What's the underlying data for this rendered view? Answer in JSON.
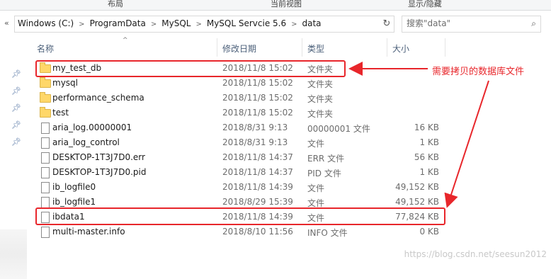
{
  "ribbon": {
    "tabs": [
      "布局",
      "当前视图",
      "显示/隐藏"
    ]
  },
  "address": {
    "crumbs": [
      "Windows (C:)",
      "ProgramData",
      "MySQL",
      "MySQL Servcie 5.6",
      "data"
    ]
  },
  "search": {
    "placeholder": "搜索\"data\""
  },
  "columns": {
    "name": "名称",
    "date": "修改日期",
    "type": "类型",
    "size": "大小"
  },
  "files": [
    {
      "name": "my_test_db",
      "date": "2018/11/8 15:02",
      "type": "文件夹",
      "size": "",
      "kind": "folder"
    },
    {
      "name": "mysql",
      "date": "2018/11/8 15:02",
      "type": "文件夹",
      "size": "",
      "kind": "folder"
    },
    {
      "name": "performance_schema",
      "date": "2018/11/8 15:02",
      "type": "文件夹",
      "size": "",
      "kind": "folder"
    },
    {
      "name": "test",
      "date": "2018/11/8 15:02",
      "type": "文件夹",
      "size": "",
      "kind": "folder"
    },
    {
      "name": "aria_log.00000001",
      "date": "2018/8/31 9:13",
      "type": "00000001 文件",
      "size": "16 KB",
      "kind": "file"
    },
    {
      "name": "aria_log_control",
      "date": "2018/8/31 9:13",
      "type": "文件",
      "size": "1 KB",
      "kind": "file"
    },
    {
      "name": "DESKTOP-1T3J7D0.err",
      "date": "2018/11/8 14:37",
      "type": "ERR 文件",
      "size": "56 KB",
      "kind": "file"
    },
    {
      "name": "DESKTOP-1T3J7D0.pid",
      "date": "2018/11/8 14:37",
      "type": "PID 文件",
      "size": "1 KB",
      "kind": "file"
    },
    {
      "name": "ib_logfile0",
      "date": "2018/11/8 14:39",
      "type": "文件",
      "size": "49,152 KB",
      "kind": "file"
    },
    {
      "name": "ib_logfile1",
      "date": "2018/8/29 15:39",
      "type": "文件",
      "size": "49,152 KB",
      "kind": "file"
    },
    {
      "name": "ibdata1",
      "date": "2018/11/8 14:39",
      "type": "文件",
      "size": "77,824 KB",
      "kind": "file"
    },
    {
      "name": "multi-master.info",
      "date": "2018/8/10 11:56",
      "type": "INFO 文件",
      "size": "0 KB",
      "kind": "file"
    }
  ],
  "annotation": {
    "text": "需要拷贝的数据库文件",
    "color": "#e8262b"
  },
  "watermark": "https://blog.csdn.net/seesun2012"
}
